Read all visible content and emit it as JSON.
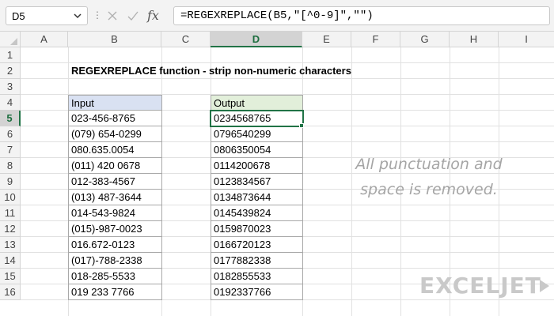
{
  "name_box": {
    "value": "D5"
  },
  "formula_bar": {
    "cancel_icon": "close-icon",
    "enter_icon": "check-icon",
    "fx_label": "fx",
    "formula": "=REGEXREPLACE(B5,\"[^0-9]\",\"\")"
  },
  "columns": [
    "A",
    "B",
    "C",
    "D",
    "E",
    "F",
    "G",
    "H",
    "I"
  ],
  "active_column": "D",
  "rows": [
    "1",
    "2",
    "3",
    "4",
    "5",
    "6",
    "7",
    "8",
    "9",
    "10",
    "11",
    "12",
    "13",
    "14",
    "15",
    "16"
  ],
  "active_row": "5",
  "title": "REGEXREPLACE function - strip non-numeric characters",
  "input_header": "Input",
  "output_header": "Output",
  "inputs": [
    "023-456-8765",
    "(079) 654-0299",
    "080.635.0054",
    "(011) 420 0678",
    "012-383-4567",
    "(013) 487-3644",
    "014-543-9824",
    "(015)-987-0023",
    "016.672-0123",
    "(017)-788-2338",
    "018-285-5533",
    "019 233 7766"
  ],
  "outputs": [
    "0234568765",
    "0796540299",
    "0806350054",
    "0114200678",
    "0123834567",
    "0134873644",
    "0145439824",
    "0159870023",
    "0166720123",
    "0177882338",
    "0182855533",
    "0192337766"
  ],
  "note": {
    "line1": "All punctuation and",
    "line2": "space is removed."
  },
  "logo": {
    "text": "EXCELJET"
  },
  "colors": {
    "selection": "#217346",
    "input_header_fill": "#d9e1f2",
    "output_header_fill": "#e2efda",
    "logo": "#c9c9c9"
  }
}
